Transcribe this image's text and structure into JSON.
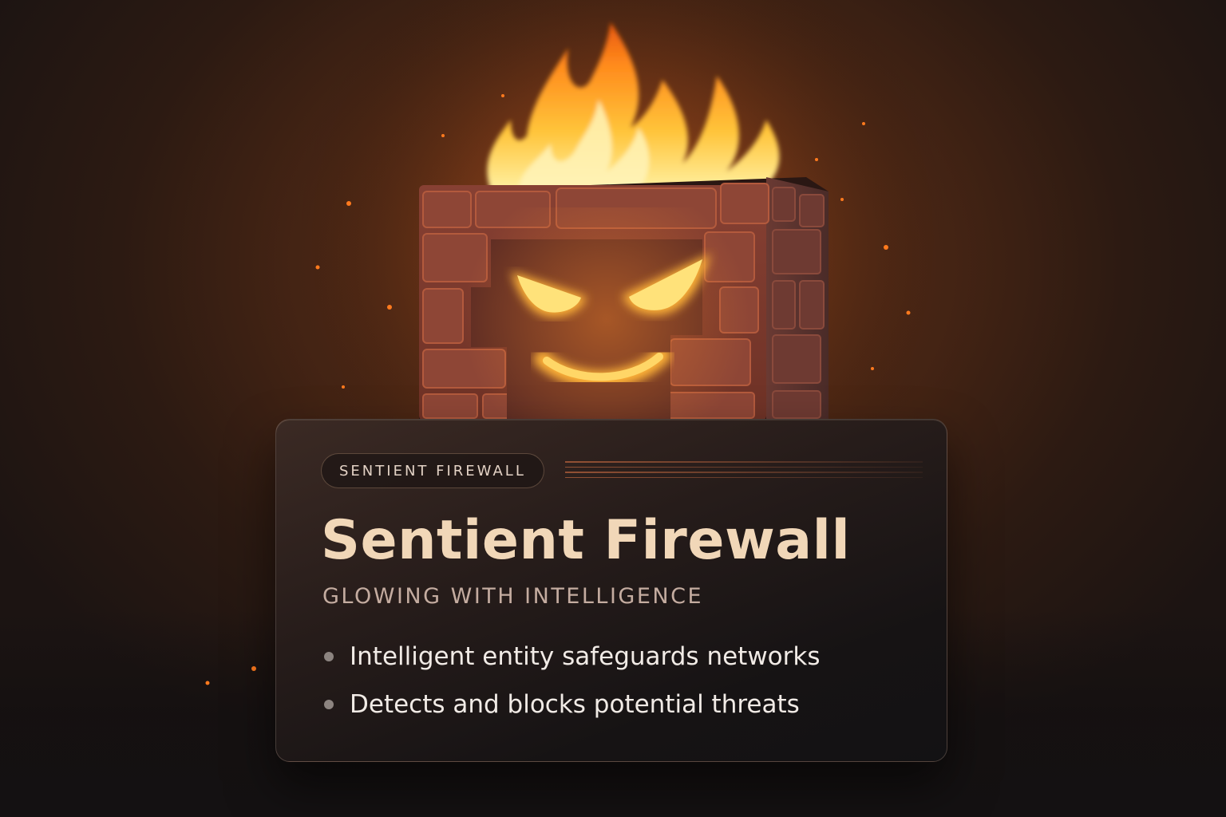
{
  "card": {
    "tag": "SENTIENT FIREWALL",
    "title": "Sentient Firewall",
    "subtitle": "GLOWING WITH INTELLIGENCE",
    "bullets": [
      "Intelligent entity safeguards networks",
      "Detects and blocks potential threats"
    ]
  },
  "illustration": {
    "subject": "flaming-brick-wall-icon",
    "colors": {
      "flame": "#ffb020",
      "brick": "#8a3f2c",
      "glow": "#ffc24a"
    }
  }
}
